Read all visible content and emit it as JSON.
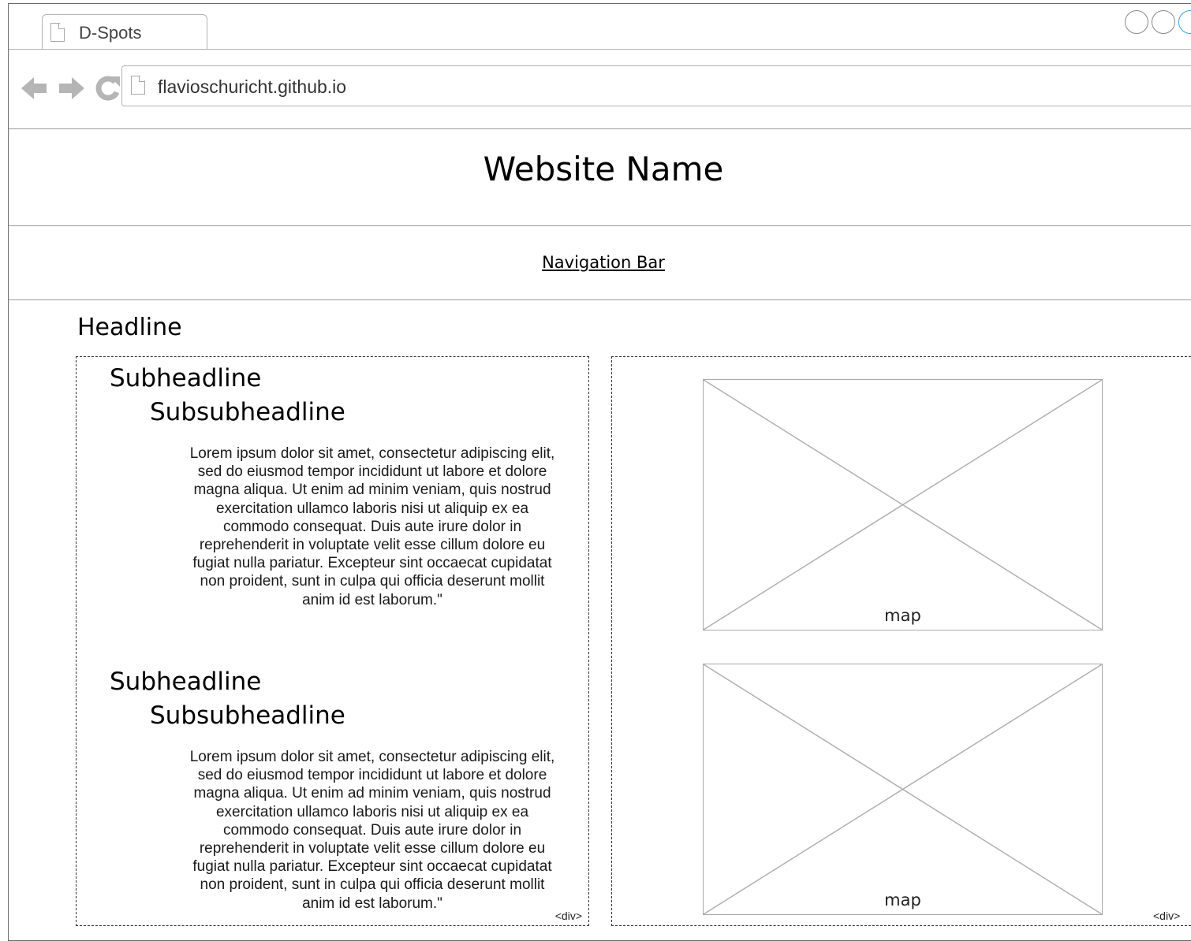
{
  "browser": {
    "tab_title": "D-Spots",
    "url": "flavioschuricht.github.io"
  },
  "site": {
    "title": "Website Name",
    "nav_label": "Navigation Bar",
    "headline": "Headline"
  },
  "content": {
    "sections": [
      {
        "subheadline": "Subheadline",
        "subsubheadline": "Subsubheadline",
        "paragraph": "Lorem ipsum dolor sit amet, consectetur adipiscing elit, sed do eiusmod tempor incididunt ut labore et dolore magna aliqua. Ut enim ad minim veniam, quis nostrud exercitation ullamco laboris nisi ut aliquip ex ea commodo consequat. Duis aute irure dolor in reprehenderit in voluptate velit esse cillum dolore eu fugiat nulla pariatur. Excepteur sint occaecat cupidatat non proident, sunt in culpa qui officia deserunt mollit anim id est laborum.\""
      },
      {
        "subheadline": "Subheadline",
        "subsubheadline": "Subsubheadline",
        "paragraph": "Lorem ipsum dolor sit amet, consectetur adipiscing elit, sed do eiusmod tempor incididunt ut labore et dolore magna aliqua. Ut enim ad minim veniam, quis nostrud exercitation ullamco laboris nisi ut aliquip ex ea commodo consequat. Duis aute irure dolor in reprehenderit in voluptate velit esse cillum dolore eu fugiat nulla pariatur. Excepteur sint occaecat cupidatat non proident, sunt in culpa qui officia deserunt mollit anim id est laborum.\""
      }
    ],
    "left_div_tag": "<div>",
    "right_div_tag": "<div>"
  },
  "maps": [
    {
      "label": "map"
    },
    {
      "label": "map"
    }
  ],
  "icons": {
    "back": "back-arrow-icon",
    "forward": "forward-arrow-icon",
    "reload": "reload-icon",
    "page": "page-icon"
  },
  "colors": {
    "window_control_accent": "#3d9ee0",
    "placeholder_stroke": "#a9a9a9"
  }
}
